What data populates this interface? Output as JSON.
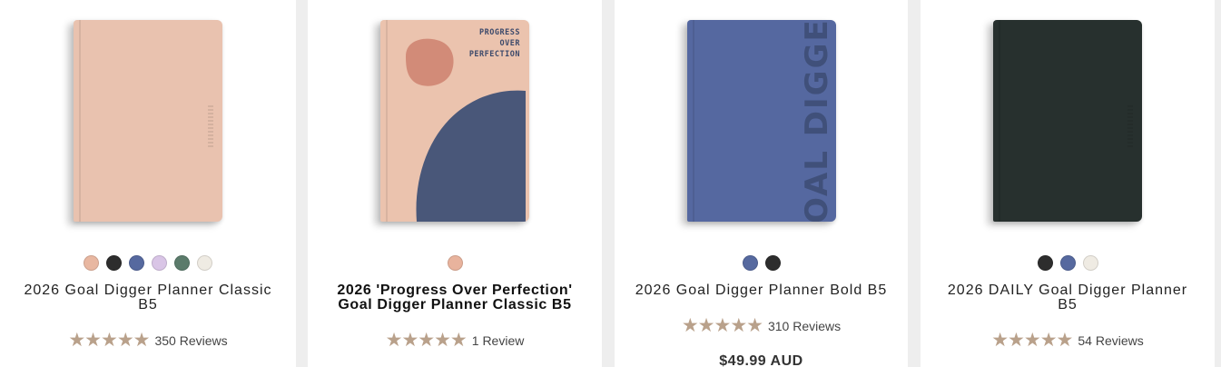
{
  "products": [
    {
      "title": "2026 Goal Digger Planner Classic B5",
      "cover_color": "#e9c2af",
      "swatches": [
        "#e8b7a1",
        "#2d2d2d",
        "#56699f",
        "#d9c5e6",
        "#5b7b6b",
        "#efebe3"
      ],
      "stars": "★★★★★",
      "reviews": "350 Reviews"
    },
    {
      "title": "2026 'Progress Over Perfection' Goal Digger Planner Classic B5",
      "cover_color": "#ebc3ae",
      "cover_text": [
        "PROGRESS",
        "OVER",
        "PERFECTION"
      ],
      "swatches": [
        "#e8b39d"
      ],
      "stars": "★★★★★",
      "reviews": "1 Review"
    },
    {
      "title": "2026 Goal Digger Planner Bold B5",
      "cover_color": "#5568a0",
      "cover_word": "GOAL DIGGER",
      "swatches": [
        "#56699f",
        "#2d2d2d"
      ],
      "stars": "★★★★★",
      "reviews": "310 Reviews",
      "price": "$49.99 AUD"
    },
    {
      "title": "2026 DAILY Goal Digger Planner B5",
      "cover_color": "#27302e",
      "swatches": [
        "#2d2d2d",
        "#56699f",
        "#efebe3"
      ],
      "stars": "★★★★★",
      "reviews": "54 Reviews"
    }
  ]
}
